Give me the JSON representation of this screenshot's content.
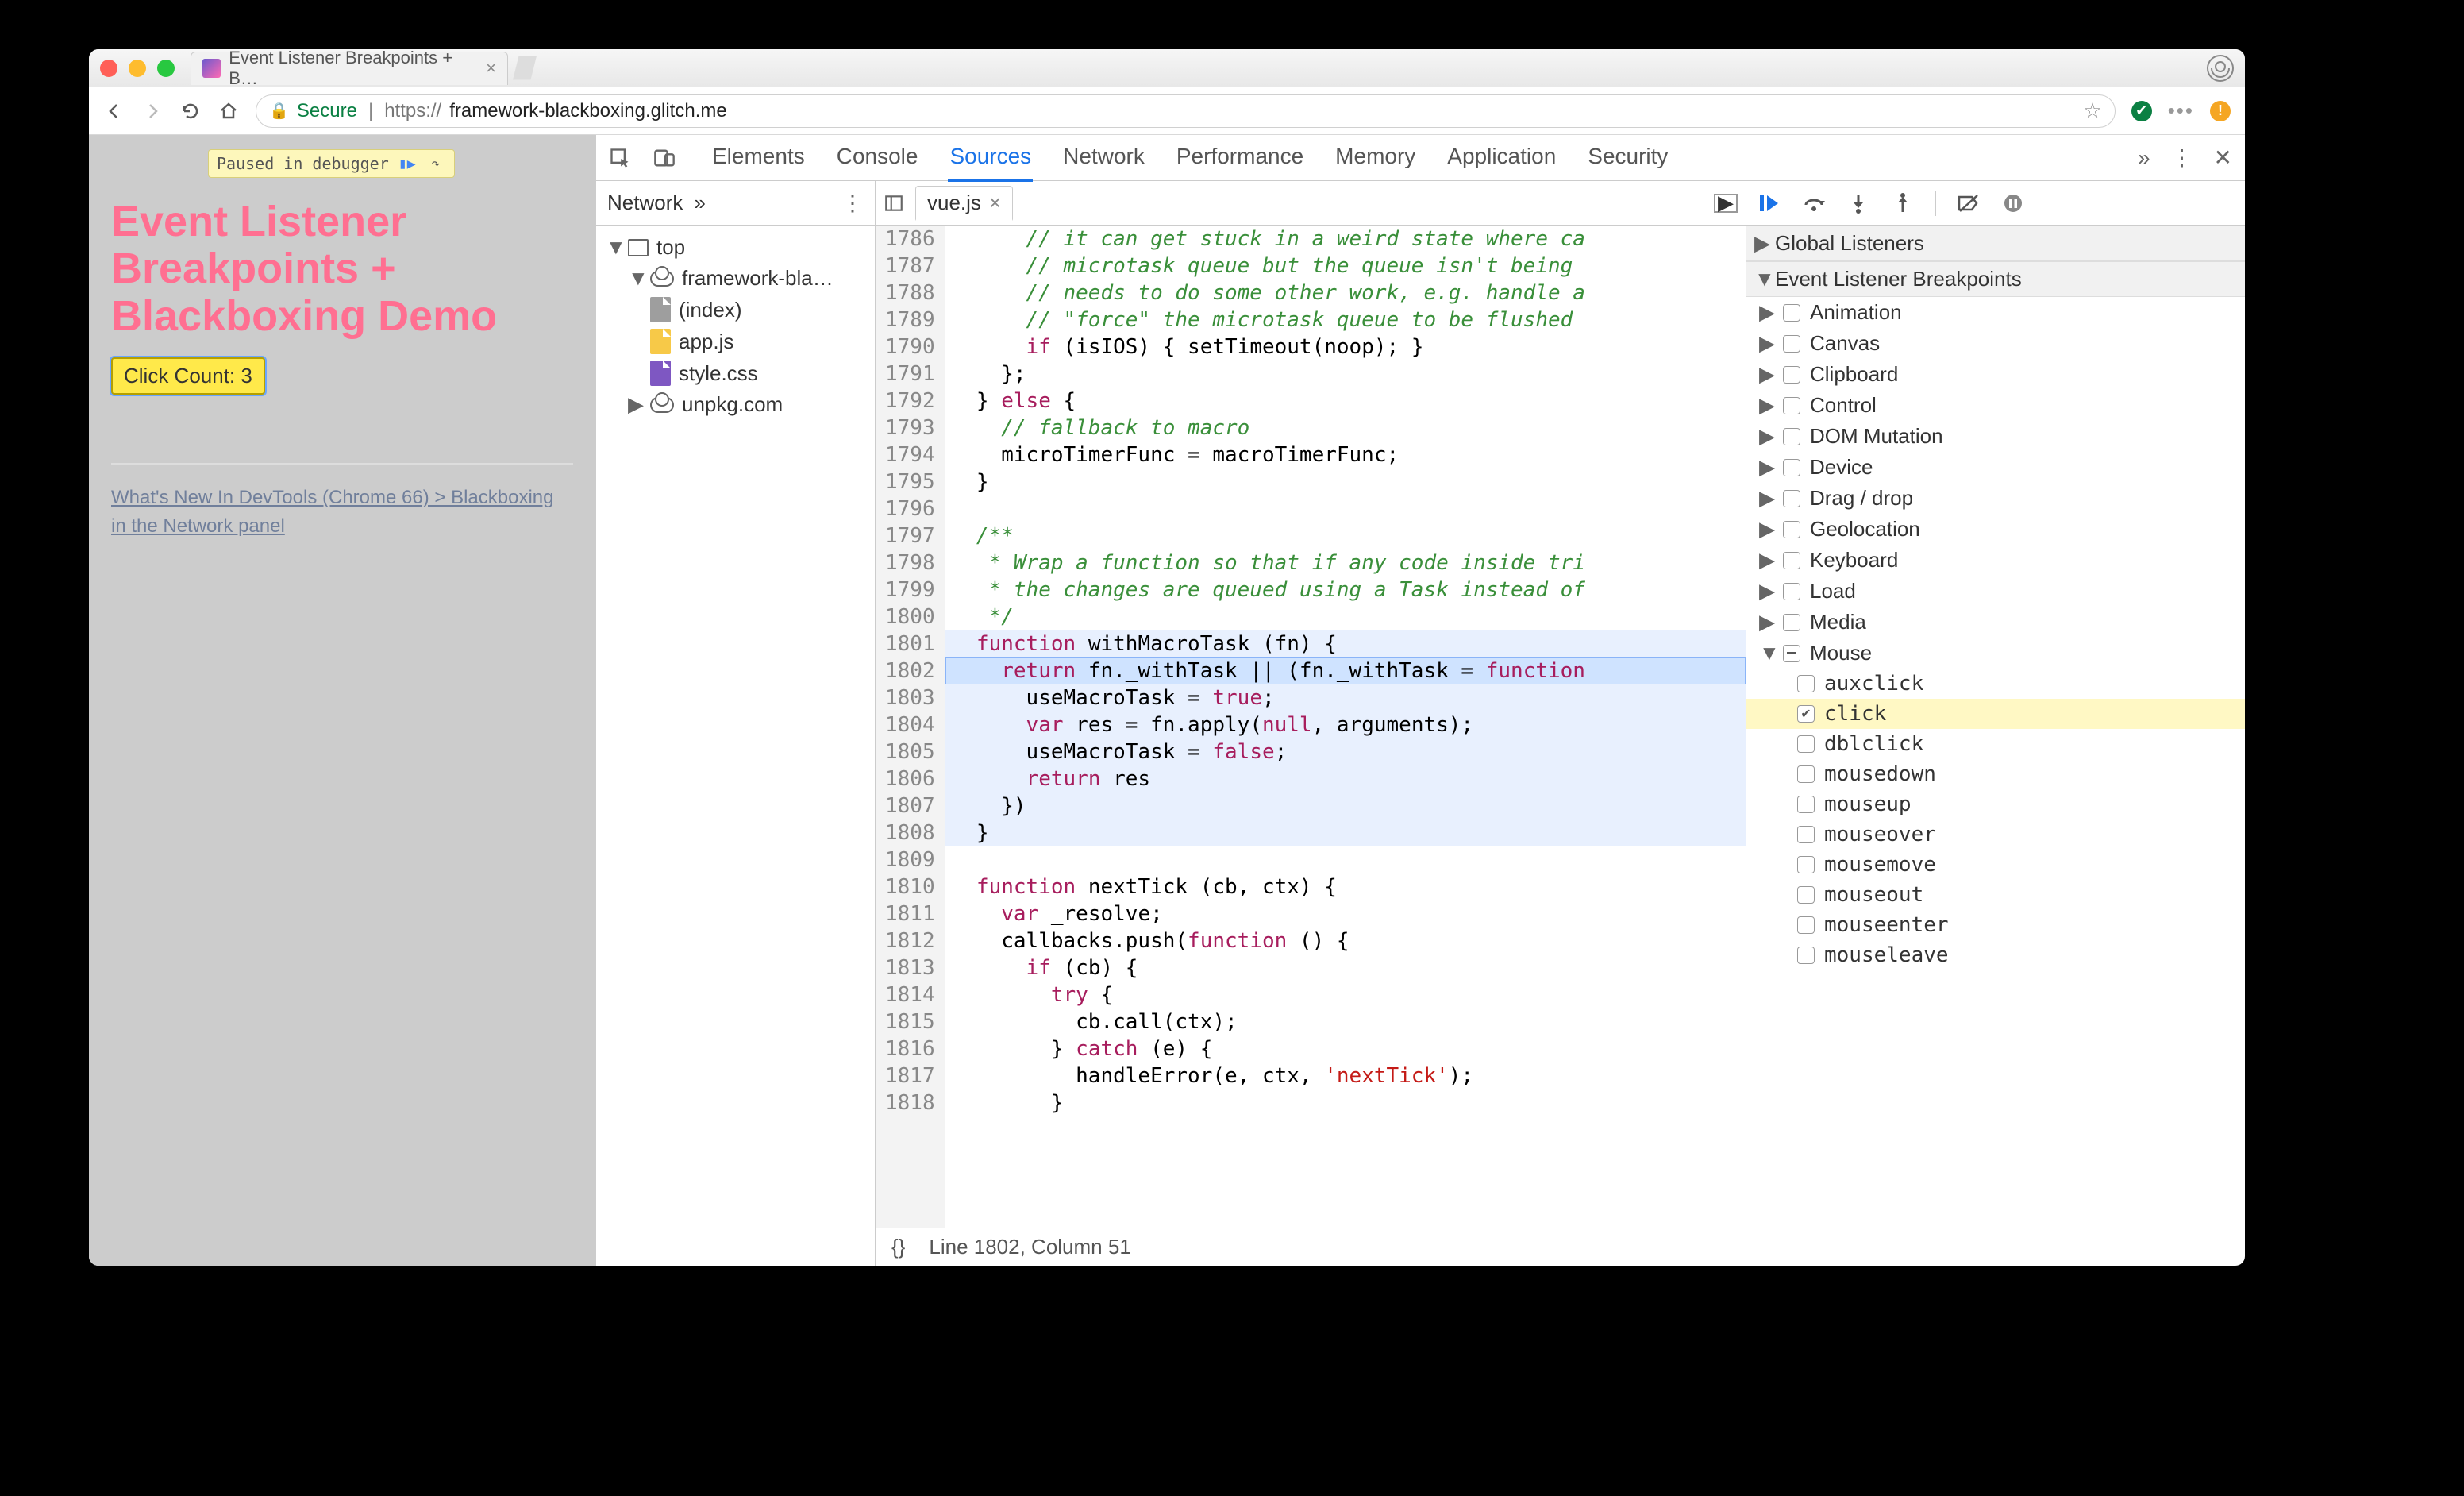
{
  "window": {
    "tab_title": "Event Listener Breakpoints + B…"
  },
  "urlbar": {
    "secure": "Secure",
    "scheme": "https://",
    "host": "framework-blackboxing.glitch.me"
  },
  "page": {
    "paused_label": "Paused in debugger",
    "heading": "Event Listener Breakpoints + Blackboxing Demo",
    "button_label": "Click Count: 3",
    "link_text": "What's New In DevTools (Chrome 66) > Blackboxing in the Network panel"
  },
  "devtools": {
    "panels": [
      "Elements",
      "Console",
      "Sources",
      "Network",
      "Performance",
      "Memory",
      "Application",
      "Security"
    ],
    "active_panel": "Sources",
    "nav_tab": "Network",
    "tree": {
      "top": "top",
      "domain1": "framework-bla…",
      "files": [
        "(index)",
        "app.js",
        "style.css"
      ],
      "domain2": "unpkg.com"
    },
    "editor": {
      "open_file": "vue.js",
      "status_line": "Line 1802, Column 51",
      "first_line": 1786,
      "lines": [
        "      // it can get stuck in a weird state where ca",
        "      // microtask queue but the queue isn't being ",
        "      // needs to do some other work, e.g. handle a",
        "      // \"force\" the microtask queue to be flushed ",
        "      if (isIOS) { setTimeout(noop); }",
        "    };",
        "  } else {",
        "    // fallback to macro",
        "    microTimerFunc = macroTimerFunc;",
        "  }",
        "",
        "  /**",
        "   * Wrap a function so that if any code inside tri",
        "   * the changes are queued using a Task instead of",
        "   */",
        "  function withMacroTask (fn) {",
        "    return fn._withTask || (fn._withTask = function",
        "      useMacroTask = true;",
        "      var res = fn.apply(null, arguments);",
        "      useMacroTask = false;",
        "      return res",
        "    })",
        "  }",
        "",
        "  function nextTick (cb, ctx) {",
        "    var _resolve;",
        "    callbacks.push(function () {",
        "      if (cb) {",
        "        try {",
        "          cb.call(ctx);",
        "        } catch (e) {",
        "          handleError(e, ctx, 'nextTick');",
        "        }"
      ],
      "highlight_block_start": 1801,
      "highlight_block_end": 1808,
      "exec_line": 1802
    },
    "sidebar": {
      "global": "Global Listeners",
      "elb": "Event Listener Breakpoints",
      "categories": [
        "Animation",
        "Canvas",
        "Clipboard",
        "Control",
        "DOM Mutation",
        "Device",
        "Drag / drop",
        "Geolocation",
        "Keyboard",
        "Load",
        "Media"
      ],
      "mouse_label": "Mouse",
      "mouse_events": [
        {
          "name": "auxclick",
          "checked": false,
          "hl": false
        },
        {
          "name": "click",
          "checked": true,
          "hl": true
        },
        {
          "name": "dblclick",
          "checked": false,
          "hl": false
        },
        {
          "name": "mousedown",
          "checked": false,
          "hl": false
        },
        {
          "name": "mouseup",
          "checked": false,
          "hl": false
        },
        {
          "name": "mouseover",
          "checked": false,
          "hl": false
        },
        {
          "name": "mousemove",
          "checked": false,
          "hl": false
        },
        {
          "name": "mouseout",
          "checked": false,
          "hl": false
        },
        {
          "name": "mouseenter",
          "checked": false,
          "hl": false
        },
        {
          "name": "mouseleave",
          "checked": false,
          "hl": false
        }
      ]
    }
  }
}
